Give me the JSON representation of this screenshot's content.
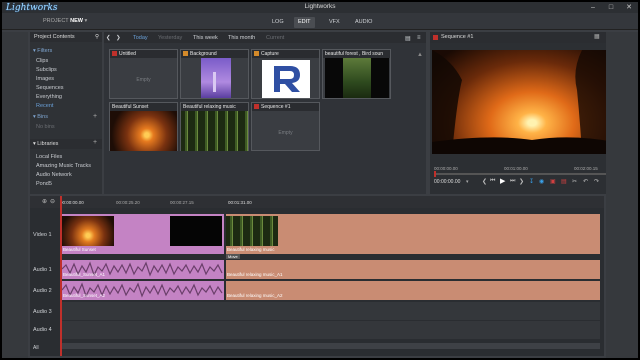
{
  "window": {
    "title": "Lightworks"
  },
  "brand": {
    "logo_text": "Lightworks",
    "project_label": "PROJECT",
    "project_name": "NEW"
  },
  "nav": {
    "tabs": [
      "LOG",
      "EDIT",
      "VFX",
      "AUDIO"
    ],
    "active": "EDIT"
  },
  "left_panel": {
    "header": "Project Contents",
    "filters_label": "Filters",
    "filters": [
      "Clips",
      "Subclips",
      "Images",
      "Sequences",
      "Everything",
      "Recent"
    ],
    "bins_label": "Bins",
    "bins_placeholder": "No bins",
    "libraries_label": "Libraries",
    "libraries": [
      "Local Files",
      "Amazing Music Tracks",
      "Audio Network",
      "Pond5"
    ]
  },
  "browser": {
    "date_filters": [
      "Today",
      "Yesterday",
      "This week",
      "This month",
      "Current"
    ],
    "active_filter": "Today",
    "empty_text": "Empty",
    "items": [
      {
        "label": "Untitled",
        "chip": "#c0302b",
        "kind": "empty"
      },
      {
        "label": "Background",
        "chip": "#d48a2a",
        "kind": "purple"
      },
      {
        "label": "Capture",
        "chip": "#d48a2a",
        "kind": "logo"
      },
      {
        "label": "beautiful forest , Bird soun",
        "chip": "",
        "kind": "forestdark"
      },
      {
        "label": "Beautiful Sunset",
        "chip": "",
        "kind": "sunset"
      },
      {
        "label": "Beautiful relaxing music",
        "chip": "",
        "kind": "forest"
      },
      {
        "label": "Sequence #1",
        "chip": "#c0302b",
        "kind": "empty"
      }
    ]
  },
  "viewer": {
    "title": "Sequence #1",
    "timecodes": [
      "00:00:00.00",
      "00:01:00.00",
      "00:02:00.15"
    ],
    "position": "00:00:00.00"
  },
  "timeline": {
    "ruler": [
      "00:00:00.00",
      "00:00:25.20",
      "00:00:27.15",
      "00:01:31.00"
    ],
    "tracks": [
      "Video 1",
      "Audio 1",
      "Audio 2",
      "Audio 3",
      "Audio 4"
    ],
    "all_label": "All",
    "clips": {
      "v1a": "Beautiful Sunset",
      "v1b": "Beautiful relaxing music",
      "a1a": "Beautiful_Sunset_A1",
      "a1b": "Beautiful relaxing music_A1",
      "a2a": "Beautiful_Sunset_A2",
      "a2b": "Beautiful relaxing music_A2"
    },
    "marker_label": "Move"
  },
  "colors": {
    "clip_pink": "#c483c4",
    "clip_salmon": "#c98c73",
    "accent": "#c0302b"
  }
}
